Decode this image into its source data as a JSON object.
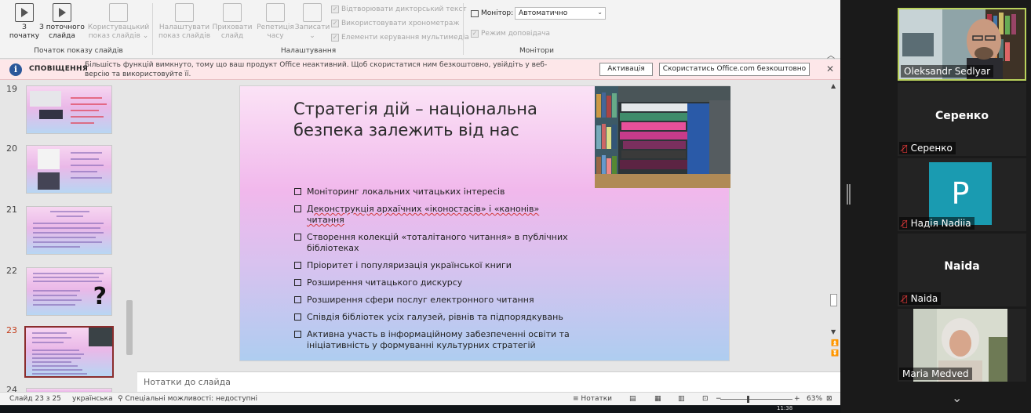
{
  "ribbon": {
    "buttons": [
      {
        "label_line1": "З",
        "label_line2": "початку",
        "disabled": false
      },
      {
        "label_line1": "З поточного",
        "label_line2": "слайда",
        "disabled": false
      },
      {
        "label_line1": "Користувацький",
        "label_line2": "показ слайдів ⌄",
        "disabled": true
      },
      {
        "label_line1": "Налаштувати",
        "label_line2": "показ слайдів",
        "disabled": true
      },
      {
        "label_line1": "Приховати",
        "label_line2": "слайд",
        "disabled": true
      },
      {
        "label_line1": "Репетиція",
        "label_line2": "часу",
        "disabled": true
      },
      {
        "label_line1": "Записати",
        "label_line2": "⌄",
        "disabled": true
      }
    ],
    "checkboxes": [
      "Відтворювати дикторський текст",
      "Використовувати хронометраж",
      "Елементи керування мультимедіа"
    ],
    "monitor_label": "Монітор:",
    "monitor_value": "Автоматично",
    "presenter_view": "Режим доповідача",
    "groups": [
      "Початок показу слайдів",
      "Налаштування",
      "Монітори"
    ]
  },
  "notification": {
    "title": "СПОВІЩЕННЯ",
    "text": "Більшість функцій вимкнуто, тому що ваш продукт Office неактивний. Щоб скористатися ним безкоштовно, увійдіть у веб-версію та використовуйте її.",
    "activate_button": "Активація",
    "free_button": "Скористатись Office.com безкоштовно"
  },
  "thumbnails": [
    {
      "number": "19",
      "active": false
    },
    {
      "number": "20",
      "active": false
    },
    {
      "number": "21",
      "active": false
    },
    {
      "number": "22",
      "active": false
    },
    {
      "number": "23",
      "active": true
    },
    {
      "number": "24",
      "active": false
    }
  ],
  "slide": {
    "title": "Стратегія дій – національна безпека залежить від нас",
    "bullets": [
      "Моніторинг локальних читацьких інтересів",
      "Деконструкція архаїчних «іконостасів» і «канонів» читання",
      "Створення колекцій «тоталітаного читання» в публічних бібліотеках",
      "Пріоритет і популяризація української книги",
      "Розширення читацького дискурсу",
      "Розширення сфери послуг електронного читання",
      "Співдія бібліотек усіх галузей, рівнів та підпорядкувань",
      "Активна участь в інформаційному забезпеченні освіти та ініціативність у формуванні культурних стратегій"
    ]
  },
  "notes_placeholder": "Нотатки до слайда",
  "status": {
    "slide_counter": "Слайд 23 з 25",
    "language": "українська",
    "accessibility": "Спеціальні можливості: недоступні",
    "notes_button": "Нотатки",
    "zoom_percent": "63%",
    "clock": "11:38"
  },
  "zoom_participants": [
    {
      "name": "Oleksandr Sedlyar",
      "type": "video",
      "speaking": true,
      "muted": false
    },
    {
      "name": "Серенко",
      "type": "name",
      "speaking": false,
      "muted": true
    },
    {
      "name": "Надія Nadiia",
      "type": "avatar",
      "avatar_letter": "P",
      "speaking": false,
      "muted": true
    },
    {
      "name": "Naida",
      "type": "name",
      "speaking": false,
      "muted": true
    },
    {
      "name": "Maria Medved",
      "type": "video",
      "speaking": false,
      "muted": false
    }
  ],
  "colors": {
    "notification_bg": "#fde7e9",
    "active_thumb": "#8b2d2d",
    "avatar_p": "#1a9bb1",
    "speaking_border": "#b9d25c"
  }
}
